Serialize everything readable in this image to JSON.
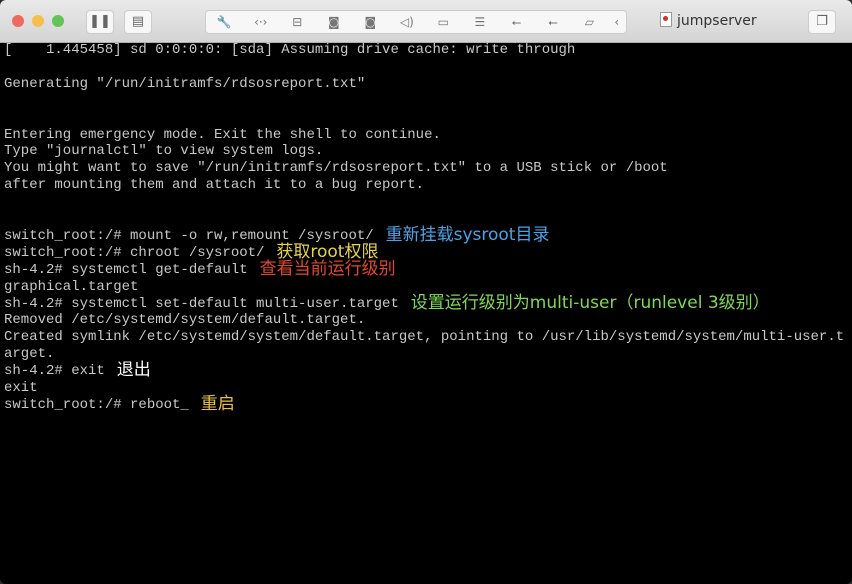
{
  "window": {
    "title": "jumpserver",
    "traffic_lights": {
      "close": "#ed6a5e",
      "minimize": "#f5bf4f",
      "zoom": "#61c554"
    }
  },
  "toolbar": {
    "icons": [
      "pause-icon",
      "snapshot-icon",
      "settings-wrench-icon",
      "network-icon",
      "disk-icon",
      "camera-icon",
      "webcam-icon",
      "sound-icon",
      "video-icon",
      "printer-icon",
      "usb-icon",
      "usb2-icon",
      "shared-folder-icon",
      "collapse-chevron-icon",
      "window-mode-icon"
    ]
  },
  "terminal": {
    "lines": [
      "[    1.445458] sd 0:0:0:0: [sda] Assuming drive cache: write through",
      "",
      "Generating \"/run/initramfs/rdsosreport.txt\"",
      "",
      "",
      "Entering emergency mode. Exit the shell to continue.",
      "Type \"journalctl\" to view system logs.",
      "You might want to save \"/run/initramfs/rdsosreport.txt\" to a USB stick or /boot",
      "after mounting them and attach it to a bug report.",
      "",
      "",
      "switch_root:/# mount -o rw,remount /sysroot/",
      "switch_root:/# chroot /sysroot/",
      "sh-4.2# systemctl get-default",
      "graphical.target",
      "sh-4.2# systemctl set-default multi-user.target",
      "Removed /etc/systemd/system/default.target.",
      "Created symlink /etc/systemd/system/default.target, pointing to /usr/lib/systemd/system/multi-user.t",
      "arget.",
      "sh-4.2# exit",
      "exit",
      "switch_root:/# reboot_"
    ]
  },
  "annotations": [
    {
      "text": "重新挂载sysroot目录",
      "color": "#4aa3e8",
      "line": 11
    },
    {
      "text": "获取root权限",
      "color": "#e8d44a",
      "line": 12
    },
    {
      "text": "查看当前运行级别",
      "color": "#e0482e",
      "line": 13
    },
    {
      "text": "设置运行级别为multi-user（runlevel 3级别）",
      "color": "#7ed957",
      "line": 15
    },
    {
      "text": "退出",
      "color": "#ffffff",
      "line": 19
    },
    {
      "text": "重启",
      "color": "#e8c34a",
      "line": 21
    }
  ]
}
